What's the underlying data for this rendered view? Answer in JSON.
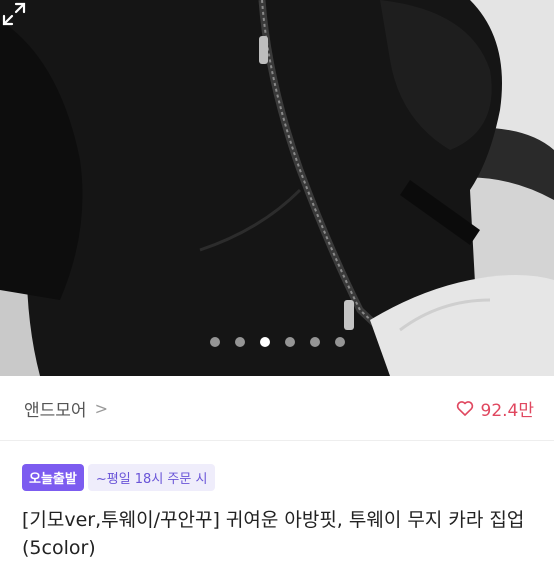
{
  "carousel": {
    "slide_count": 6,
    "active_index": 2
  },
  "seller": {
    "name": "앤드모어",
    "chevron": ">"
  },
  "likes": {
    "count": "92.4만",
    "icon": "heart-outline-icon",
    "color": "#e0475f"
  },
  "badges": {
    "today_label": "오늘출발",
    "time_label": "~평일 18시 주문 시",
    "accent": "#7c5cf0"
  },
  "product": {
    "title": "[기모ver,투웨이/꾸안꾸] 귀여운 아방핏, 투웨이 무지 카라 집업 (5color)"
  }
}
